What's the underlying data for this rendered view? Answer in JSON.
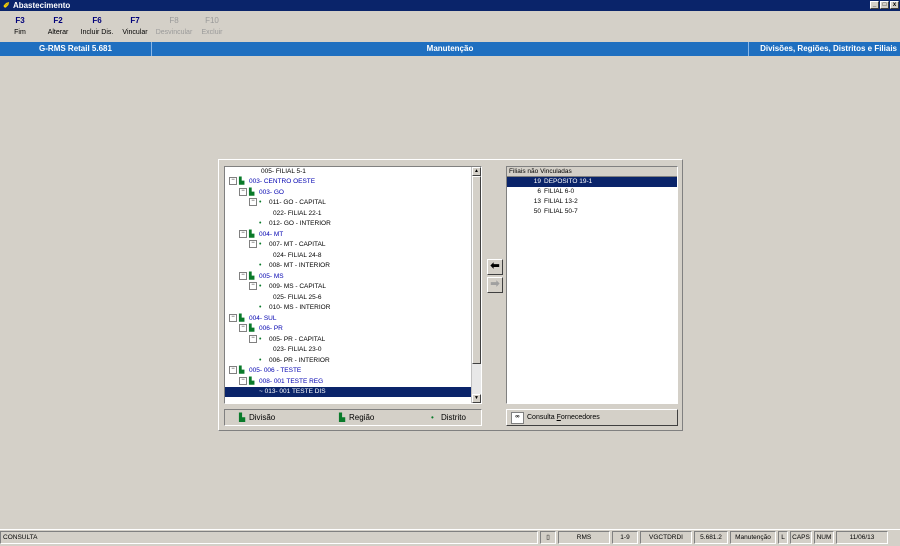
{
  "window": {
    "title": "Abastecimento",
    "icon": "app-pen-icon",
    "controls": [
      "_",
      "□",
      "x"
    ]
  },
  "toolbar": [
    {
      "key": "F3",
      "label": "Fim",
      "enabled": true
    },
    {
      "key": "F2",
      "label": "Alterar",
      "enabled": true
    },
    {
      "key": "F6",
      "label": "Incluir Dis.",
      "enabled": true
    },
    {
      "key": "F7",
      "label": "Vincular",
      "enabled": true
    },
    {
      "key": "F8",
      "label": "Desvincular",
      "enabled": false
    },
    {
      "key": "F10",
      "label": "Excluir",
      "enabled": false
    }
  ],
  "header": {
    "app": "G-RMS Retail 5.681",
    "mode": "Manutenção",
    "screen": "Divisões, Regiões, Distritos e Filiais"
  },
  "tree": [
    {
      "text": "005- FILIAL 5-1",
      "color": "black"
    },
    {
      "text": "003- CENTRO OESTE",
      "color": "blue"
    },
    {
      "text": "003- GO",
      "color": "blue"
    },
    {
      "text": "011- GO - CAPITAL",
      "color": "black"
    },
    {
      "text": "022- FILIAL 22-1",
      "color": "black"
    },
    {
      "text": "012- GO - INTERIOR",
      "color": "black"
    },
    {
      "text": "004- MT",
      "color": "blue"
    },
    {
      "text": "007- MT - CAPITAL",
      "color": "black"
    },
    {
      "text": "024- FILIAL 24-8",
      "color": "black"
    },
    {
      "text": "008- MT - INTERIOR",
      "color": "black"
    },
    {
      "text": "005- MS",
      "color": "blue"
    },
    {
      "text": "009- MS - CAPITAL",
      "color": "black"
    },
    {
      "text": "025- FILIAL 25-6",
      "color": "black"
    },
    {
      "text": "010- MS - INTERIOR",
      "color": "black"
    },
    {
      "text": "004- SUL",
      "color": "blue"
    },
    {
      "text": "006- PR",
      "color": "blue"
    },
    {
      "text": "005- PR - CAPITAL",
      "color": "black"
    },
    {
      "text": "023- FILIAL 23-0",
      "color": "black"
    },
    {
      "text": "006- PR - INTERIOR",
      "color": "black"
    },
    {
      "text": "005- 006 - TESTE",
      "color": "blue"
    },
    {
      "text": "008- 001 TESTE REG",
      "color": "blue"
    },
    {
      "text": "013- 001 TESTE DIS",
      "color": "black",
      "selected": true
    }
  ],
  "list": {
    "header": "Filiais não Vinculadas",
    "items": [
      {
        "num": "19",
        "name": "DEPOSITO 19-1",
        "selected": true
      },
      {
        "num": "6",
        "name": "FILIAL 6-0"
      },
      {
        "num": "13",
        "name": "FILIAL 13-2"
      },
      {
        "num": "50",
        "name": "FILIAL 50-7"
      }
    ]
  },
  "buttons": {
    "divisao": "Divisão",
    "regiao": "Região",
    "distrito": "Distrito",
    "consulta_prefix": "Consulta ",
    "consulta_underline": "F",
    "consulta_suffix": "ornecedores"
  },
  "status": [
    "CONSULTA",
    "",
    "RMS",
    "1-9",
    "VGCTDRDI",
    "5.681.2",
    "Manutenção",
    "L",
    "CAPS",
    "NUM",
    "11/06/13"
  ]
}
